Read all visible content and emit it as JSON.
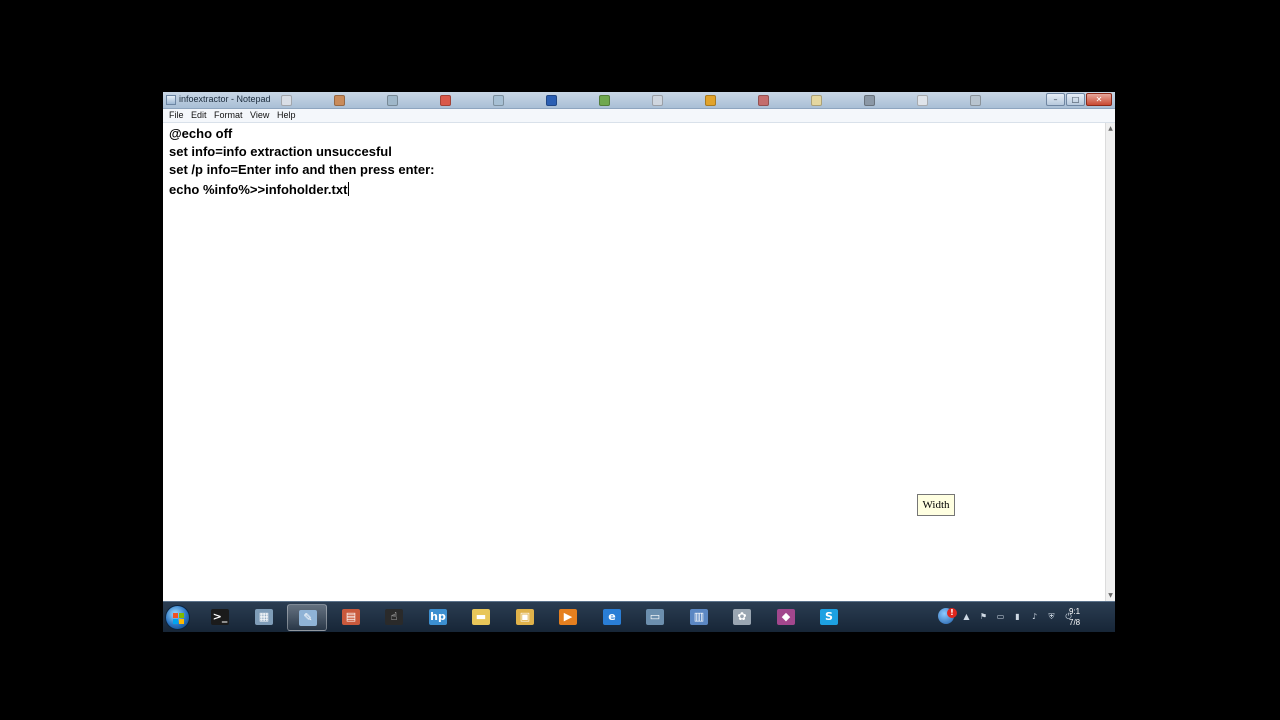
{
  "window": {
    "title": "infoextractor - Notepad",
    "controls": {
      "minimize": "–",
      "maximize": "□",
      "close": "✕"
    }
  },
  "title_bar_icons": [
    {
      "name": "doc-icon",
      "color": "#d9dee6"
    },
    {
      "name": "paint-icon",
      "color": "#c98b5a"
    },
    {
      "name": "monitor-icon",
      "color": "#9fb7c9"
    },
    {
      "name": "app-red-icon",
      "color": "#d9584a"
    },
    {
      "name": "network-icon",
      "color": "#a7c0d4"
    },
    {
      "name": "word-icon",
      "color": "#2b5fb3"
    },
    {
      "name": "tools-icon",
      "color": "#6fa84f"
    },
    {
      "name": "doc2-icon",
      "color": "#cfd6df"
    },
    {
      "name": "orange-circle-icon",
      "color": "#e1a32b"
    },
    {
      "name": "box-icon",
      "color": "#c46d6d"
    },
    {
      "name": "note-icon",
      "color": "#e4d7a0"
    },
    {
      "name": "dots-icon",
      "color": "#8b98a6"
    },
    {
      "name": "file-icon",
      "color": "#dfe4ea"
    },
    {
      "name": "recycle-icon",
      "color": "#b8c4cf"
    }
  ],
  "menu": [
    "File",
    "Edit",
    "Format",
    "View",
    "Help"
  ],
  "editor": {
    "lines": [
      "@echo off",
      "set info=info extraction unsuccesful",
      "set /p info=Enter info and then press enter:",
      "echo %info%>>infoholder.txt"
    ]
  },
  "taskbar": {
    "pinned": [
      {
        "name": "cmd-icon",
        "glyph": ">_",
        "color": "#1b1b1b",
        "active": false
      },
      {
        "name": "calculator-icon",
        "glyph": "▦",
        "color": "#7f9db8",
        "active": false
      },
      {
        "name": "notepad-icon",
        "glyph": "✎",
        "color": "#8fb3d6",
        "active": true
      },
      {
        "name": "printer-icon",
        "glyph": "▤",
        "color": "#c9593c",
        "active": false
      },
      {
        "name": "pointer-icon",
        "glyph": "☝",
        "color": "#2a2a2a",
        "active": false
      },
      {
        "name": "hp-icon",
        "glyph": "hp",
        "color": "#3c8fd0",
        "active": false
      },
      {
        "name": "folder-icon",
        "glyph": "▬",
        "color": "#e8c659",
        "active": false
      },
      {
        "name": "explorer-icon",
        "glyph": "▣",
        "color": "#e0b24a",
        "active": false
      },
      {
        "name": "media-player-icon",
        "glyph": "▶",
        "color": "#e57f1f",
        "active": false
      },
      {
        "name": "internet-explorer-icon",
        "glyph": "e",
        "color": "#2a7ed6",
        "active": false
      },
      {
        "name": "remote-desktop-icon",
        "glyph": "▭",
        "color": "#6c8fae",
        "active": false
      },
      {
        "name": "contacts-icon",
        "glyph": "▥",
        "color": "#5b87c3",
        "active": false
      },
      {
        "name": "paint-icon",
        "glyph": "✿",
        "color": "#9aa6b2",
        "active": false
      },
      {
        "name": "app-badge-icon",
        "glyph": "◆",
        "color": "#a2478d",
        "active": false
      },
      {
        "name": "skype-icon",
        "glyph": "S",
        "color": "#1da1e2",
        "active": false
      }
    ],
    "tray": {
      "alert_badge": "!",
      "icons": [
        {
          "name": "show-hidden-icon",
          "glyph": "▲"
        },
        {
          "name": "flag-icon",
          "glyph": "⚑"
        },
        {
          "name": "monitor-tray-icon",
          "glyph": "▭"
        },
        {
          "name": "signal-icon",
          "glyph": "▮"
        },
        {
          "name": "volume-icon",
          "glyph": "♪"
        },
        {
          "name": "security-icon",
          "glyph": "⛨"
        },
        {
          "name": "power-icon",
          "glyph": "⏻"
        }
      ]
    },
    "clock": {
      "time": "9:1",
      "date": "7/8"
    }
  },
  "tooltip": "Width",
  "colors": {
    "title_bar": "#b7c9dc",
    "taskbar": "#1f3044",
    "editor_bg": "#ffffff"
  }
}
